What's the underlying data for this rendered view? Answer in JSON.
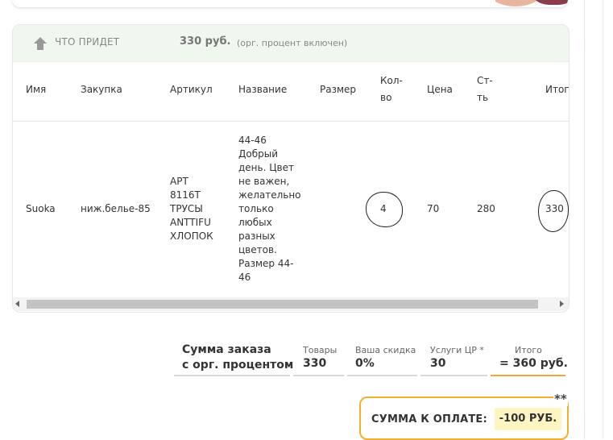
{
  "order_panel": {
    "header": {
      "label": "ЧТО ПРИДЕТ",
      "amount": "330 руб.",
      "note": "(орг. процент включен)"
    },
    "columns": [
      "Имя",
      "Закупка",
      "Артикул",
      "Название",
      "Размер",
      "Кол-\nво",
      "Цена",
      "Ст-\nть",
      "Итого"
    ],
    "rows": [
      {
        "name": "Suoka",
        "purchase": "ниж.белье-85",
        "article": "АРТ\n8116Т\nТРУСЫ\nANTTIFU\nХЛОПОК",
        "title": "44-46\nДобрый\nдень. Цвет\nне важен,\nжелательно\nтолько\nлюбых\nразных\nцветов.\nРазмер 44-\n46",
        "size": "",
        "qty": "4",
        "price": "70",
        "cost": "280",
        "total": "330"
      }
    ]
  },
  "summary": {
    "title": "Сумма заказа\nс орг. процентом",
    "goods_label": "Товары",
    "goods_value": "330",
    "discount_label": "Ваша скидка",
    "discount_value": "0%",
    "services_label": "Услуги ЦР *",
    "services_value": "30",
    "total_label": "Итого",
    "total_value": "= 360 руб."
  },
  "payment": {
    "label": "СУММА К ОПЛАТЕ:",
    "value": "-100 РУБ.",
    "footnote": "**"
  },
  "colors": {
    "header_bg": "#f0f7ef",
    "accent": "#f0b030",
    "highlight": "#fdf6c3"
  }
}
